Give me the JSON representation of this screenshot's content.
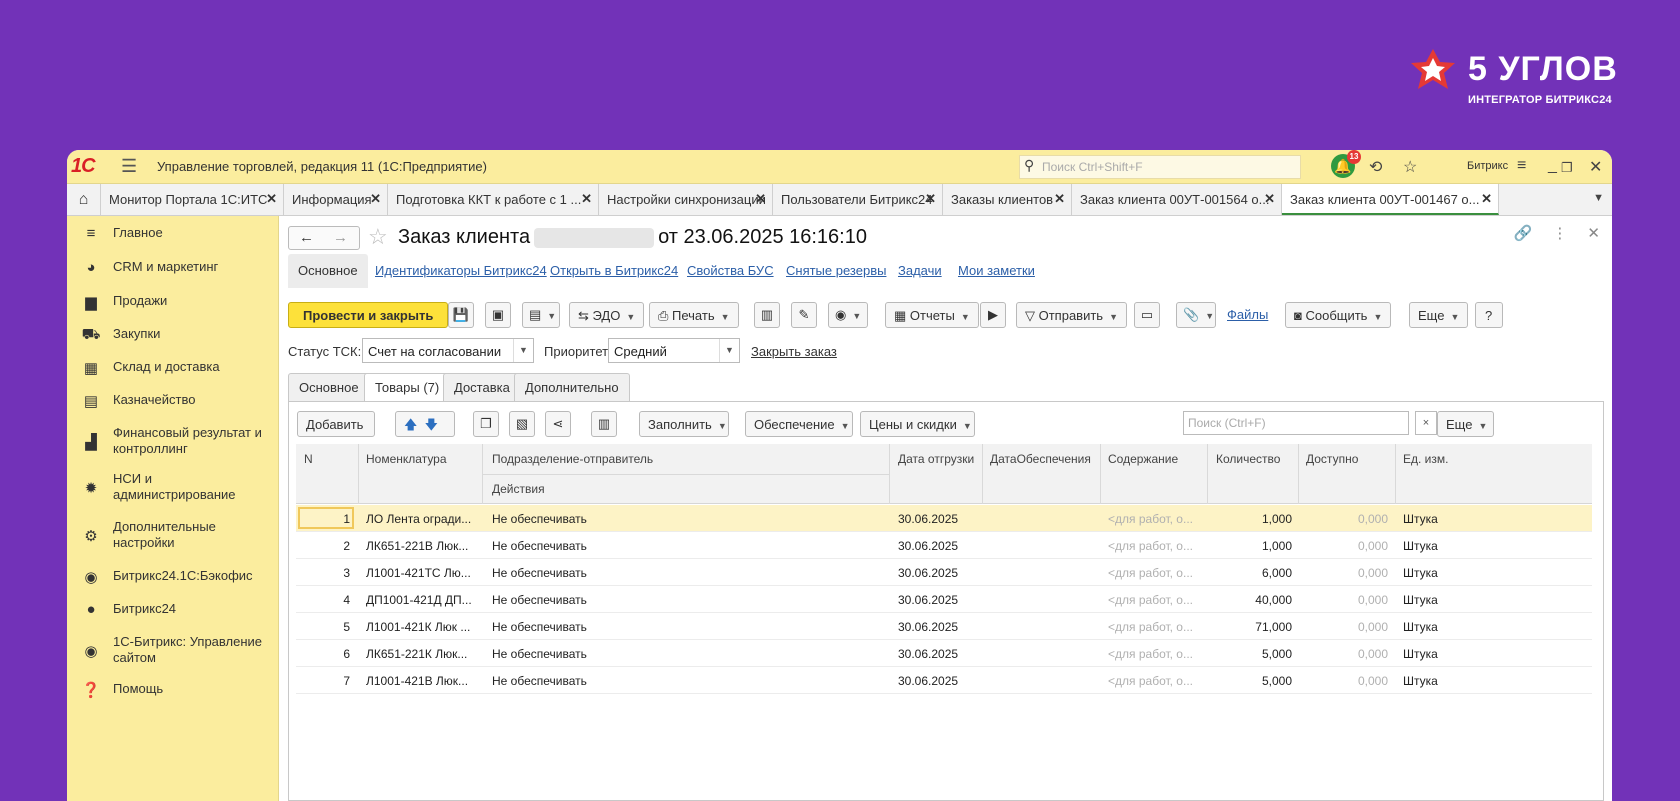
{
  "brand": {
    "name": "5 УГЛОВ",
    "subtitle": "ИНТЕГРАТОР БИТРИКС24",
    "accent": "#e53935"
  },
  "titlebar": {
    "logo": "1С",
    "app_title": "Управление торговлей, редакция 11  (1С:Предприятие)",
    "search_placeholder": "Поиск Ctrl+Shift+F",
    "notifications_count": "13",
    "user": "Битрикс"
  },
  "tabs": [
    {
      "label": "Монитор Портала 1С:ИТС"
    },
    {
      "label": "Информация"
    },
    {
      "label": "Подготовка ККТ к работе с 1 ..."
    },
    {
      "label": "Настройки синхронизации"
    },
    {
      "label": "Пользователи Битрикс24"
    },
    {
      "label": "Заказы клиентов"
    },
    {
      "label": "Заказ клиента 00УТ-001564 о..."
    },
    {
      "label": "Заказ клиента 00УТ-001467 о..."
    }
  ],
  "sidebar": {
    "items": [
      {
        "label": "Главное",
        "icon": "menu-icon"
      },
      {
        "label": "CRM и маркетинг",
        "icon": "pie-chart-icon"
      },
      {
        "label": "Продажи",
        "icon": "bag-icon"
      },
      {
        "label": "Закупки",
        "icon": "cart-icon"
      },
      {
        "label": "Склад и доставка",
        "icon": "warehouse-icon"
      },
      {
        "label": "Казначейство",
        "icon": "cash-icon"
      },
      {
        "label": "Финансовый результат и контроллинг",
        "icon": "bar-chart-icon"
      },
      {
        "label": "НСИ и администрирование",
        "icon": "gear-icon"
      },
      {
        "label": "Дополнительные настройки",
        "icon": "gear-outline-icon"
      },
      {
        "label": "Битрикс24.1С:Бэкофис",
        "icon": "b24-circle-icon"
      },
      {
        "label": "Битрикс24",
        "icon": "b24-icon"
      },
      {
        "label": "1С-Битрикс: Управление сайтом",
        "icon": "site-icon"
      },
      {
        "label": "Помощь",
        "icon": "help-icon"
      }
    ]
  },
  "document": {
    "title_prefix": "Заказ клиента",
    "title_suffix": "от 23.06.2025 16:16:10",
    "subnav": {
      "first": "Основное",
      "links": [
        "Идентификаторы Битрикс24",
        "Открыть в Битрикс24",
        "Свойства БУС",
        "Снятые резервы",
        "Задачи",
        "Мои заметки"
      ]
    },
    "commands": {
      "post_close": "Провести и закрыть",
      "edo": "ЭДО",
      "print": "Печать",
      "reports": "Отчеты",
      "send": "Отправить",
      "files": "Файлы",
      "message": "Сообщить",
      "more": "Еще",
      "help": "?"
    },
    "status": {
      "tsk_label": "Статус ТСК:",
      "tsk_value": "Счет на согласовании",
      "priority_label": "Приоритет:",
      "priority_value": "Средний",
      "close_link": "Закрыть заказ"
    },
    "inner_tabs": [
      "Основное",
      "Товары (7)",
      "Доставка",
      "Дополнительно"
    ],
    "goods_toolbar": {
      "add": "Добавить",
      "fill": "Заполнить",
      "provision": "Обеспечение",
      "prices": "Цены и скидки",
      "search_placeholder": "Поиск (Ctrl+F)",
      "clear": "×",
      "more": "Еще"
    },
    "table": {
      "headers": {
        "n": "N",
        "nomenclature": "Номенклатура",
        "subdivision": "Подразделение-отправитель",
        "actions": "Действия",
        "ship_date": "Дата отгрузки",
        "provision_date": "ДатаОбеспечения",
        "content": "Содержание",
        "qty": "Количество",
        "available": "Доступно",
        "unit": "Ед. изм."
      },
      "rows": [
        {
          "n": "1",
          "name": "ЛО Лента огради...",
          "action": "Не обеспечивать",
          "date": "30.06.2025",
          "content": "<для работ, о...",
          "qty": "1,000",
          "avail": "0,000",
          "unit": "Штука"
        },
        {
          "n": "2",
          "name": "ЛК651-221В Люк...",
          "action": "Не обеспечивать",
          "date": "30.06.2025",
          "content": "<для работ, о...",
          "qty": "1,000",
          "avail": "0,000",
          "unit": "Штука"
        },
        {
          "n": "3",
          "name": "Л1001-421ТС Лю...",
          "action": "Не обеспечивать",
          "date": "30.06.2025",
          "content": "<для работ, о...",
          "qty": "6,000",
          "avail": "0,000",
          "unit": "Штука"
        },
        {
          "n": "4",
          "name": "ДП1001-421Д ДП...",
          "action": "Не обеспечивать",
          "date": "30.06.2025",
          "content": "<для работ, о...",
          "qty": "40,000",
          "avail": "0,000",
          "unit": "Штука"
        },
        {
          "n": "5",
          "name": "Л1001-421К Люк ...",
          "action": "Не обеспечивать",
          "date": "30.06.2025",
          "content": "<для работ, о...",
          "qty": "71,000",
          "avail": "0,000",
          "unit": "Штука"
        },
        {
          "n": "6",
          "name": "ЛК651-221К Люк...",
          "action": "Не обеспечивать",
          "date": "30.06.2025",
          "content": "<для работ, о...",
          "qty": "5,000",
          "avail": "0,000",
          "unit": "Штука"
        },
        {
          "n": "7",
          "name": "Л1001-421В Люк...",
          "action": "Не обеспечивать",
          "date": "30.06.2025",
          "content": "<для работ, о...",
          "qty": "5,000",
          "avail": "0,000",
          "unit": "Штука"
        }
      ]
    }
  }
}
